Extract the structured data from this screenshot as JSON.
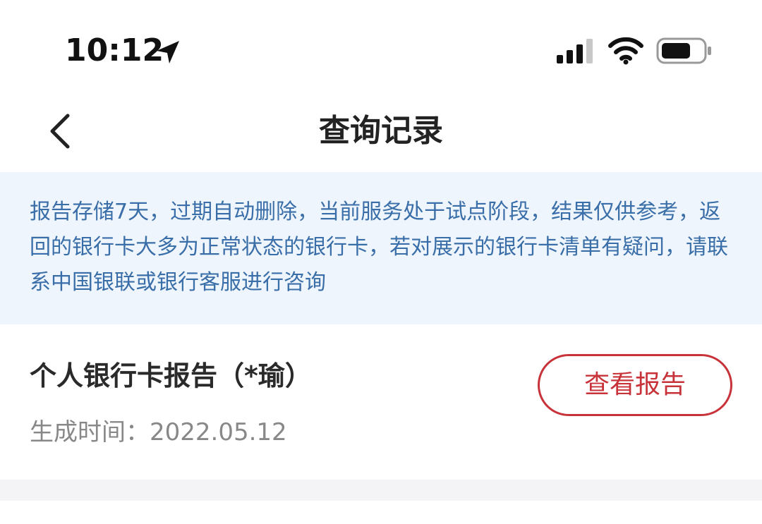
{
  "status_bar": {
    "time": "10:12",
    "icons": [
      "location-arrow-icon",
      "cellular-signal-icon",
      "wifi-icon",
      "battery-icon"
    ]
  },
  "nav": {
    "back_icon": "chevron-left-icon",
    "title": "查询记录"
  },
  "notice": {
    "text": "报告存储7天，过期自动删除，当前服务处于试点阶段，结果仅供参考，返回的银行卡大多为正常状态的银行卡，若对展示的银行卡清单有疑问，请联系中国银联或银行客服进行咨询"
  },
  "records": [
    {
      "title": "个人银行卡报告（*瑜）",
      "time_label": "生成时间：",
      "time_value": "2022.05.12",
      "button_label": "查看报告"
    }
  ],
  "colors": {
    "notice_bg": "#eef5fc",
    "notice_text": "#3a6ea8",
    "accent_red": "#c8333a",
    "title_text": "#222222",
    "muted_text": "#888888"
  }
}
